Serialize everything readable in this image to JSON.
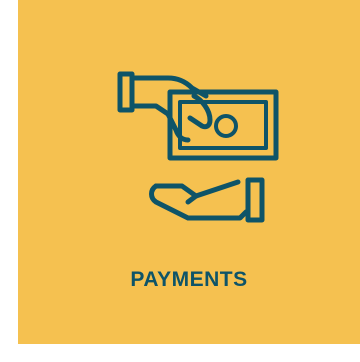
{
  "tile": {
    "label": "PAYMENTS",
    "icon": "hand-giving-money-to-hand-icon",
    "background_color": "#f5c150",
    "accent_color": "#0e5468"
  }
}
